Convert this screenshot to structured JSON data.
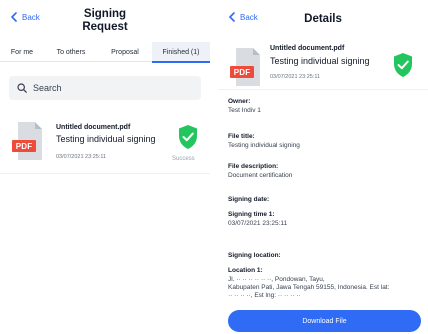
{
  "left": {
    "back_label": "Back",
    "title": "Signing Request",
    "tabs": [
      {
        "label": "For me"
      },
      {
        "label": "To others"
      },
      {
        "label": "Proposal"
      },
      {
        "label": "Finished (1)"
      }
    ],
    "search_placeholder": "Search",
    "document": {
      "icon_label": "PDF",
      "name": "Untitled document.pdf",
      "title": "Testing individual signing",
      "date": "03/07/2021 23:25:11",
      "status": "Success"
    }
  },
  "right": {
    "back_label": "Back",
    "title": "Details",
    "document": {
      "icon_label": "PDF",
      "name": "Untitled document.pdf",
      "title": "Testing individual signing",
      "date": "03/07/2021 23:25:11"
    },
    "fields": {
      "owner_label": "Owner:",
      "owner_value": "Test Indiv 1",
      "file_title_label": "File title:",
      "file_title_value": "Testing individual signing",
      "file_description_label": "File description:",
      "file_description_value": "Document certification",
      "signing_date_label": "Signing date:",
      "signing_time_label": "Signing time 1:",
      "signing_time_value": "03/07/2021 23:25:11",
      "signing_location_label": "Signing location:",
      "location_label": "Location 1:",
      "location_line1": "Jl. ·· ·· ·· ·· ·· ··, Pondowan, Tayu,",
      "location_line2": "Kabupaten Pati, Jawa Tengah 59155, Indonesia. Est lat:",
      "location_line3": "·· ·· ·· ··, Est lng: ·· ·· ·· ··"
    },
    "download_label": "Download File"
  },
  "colors": {
    "accent": "#2f6bf5",
    "success": "#22c55e",
    "pdf_red": "#ef4b3a"
  }
}
